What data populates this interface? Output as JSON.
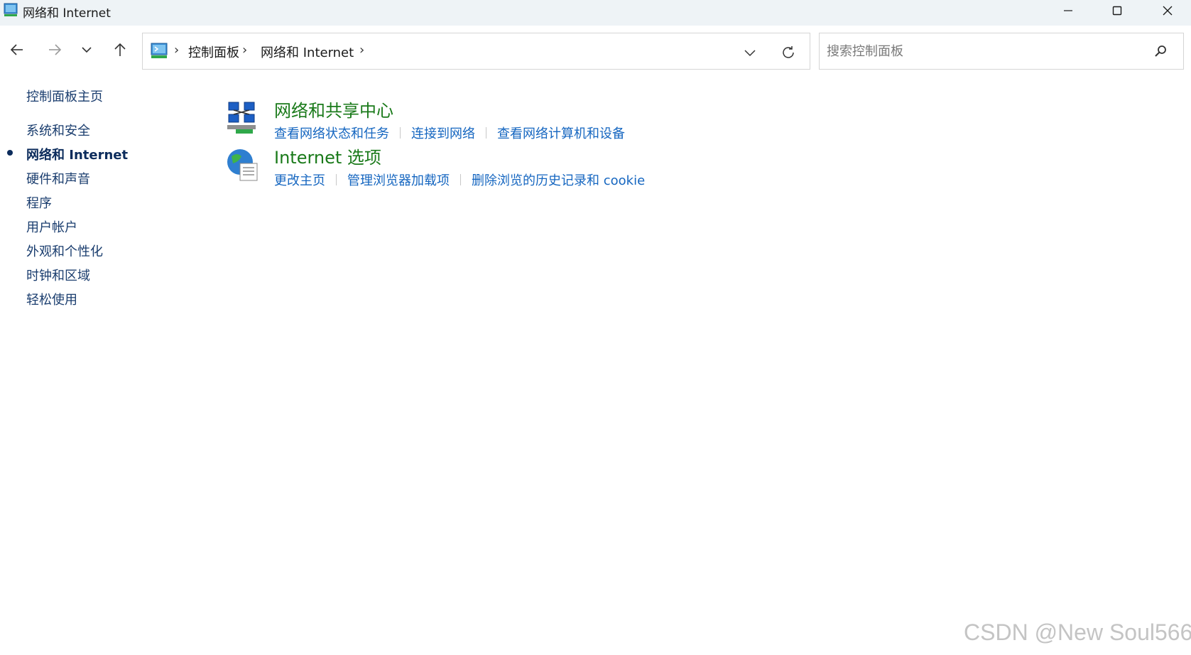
{
  "window": {
    "title": "网络和 Internet"
  },
  "address": {
    "crumbs": [
      "控制面板",
      "网络和 Internet"
    ]
  },
  "search": {
    "placeholder": "搜索控制面板"
  },
  "sidebar": {
    "items": [
      {
        "label": "控制面板主页",
        "active": false
      },
      {
        "label": "系统和安全",
        "active": false
      },
      {
        "label": "网络和 Internet",
        "active": true
      },
      {
        "label": "硬件和声音",
        "active": false
      },
      {
        "label": "程序",
        "active": false
      },
      {
        "label": "用户帐户",
        "active": false
      },
      {
        "label": "外观和个性化",
        "active": false
      },
      {
        "label": "时钟和区域",
        "active": false
      },
      {
        "label": "轻松使用",
        "active": false
      }
    ]
  },
  "categories": [
    {
      "title": "网络和共享中心",
      "icon": "network-sharing-icon",
      "links": [
        "查看网络状态和任务",
        "连接到网络",
        "查看网络计算机和设备"
      ]
    },
    {
      "title": "Internet 选项",
      "icon": "internet-options-icon",
      "links": [
        "更改主页",
        "管理浏览器加载项",
        "删除浏览的历史记录和 cookie"
      ]
    }
  ],
  "watermark": "CSDN @New Soul566",
  "colors": {
    "title_bar": "#eef3f6",
    "category_title": "#1a7a1a",
    "link": "#1566c0",
    "sidebar_text": "#1a3d6e"
  }
}
